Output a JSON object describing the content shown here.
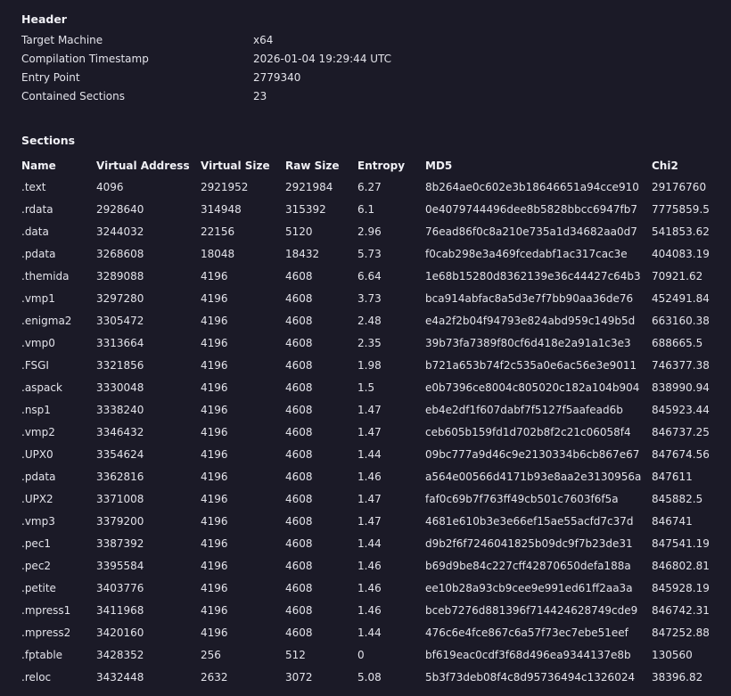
{
  "header": {
    "title": "Header",
    "fields": [
      {
        "key": "Target Machine",
        "value": "x64"
      },
      {
        "key": "Compilation Timestamp",
        "value": "2026-01-04 19:29:44 UTC"
      },
      {
        "key": "Entry Point",
        "value": "2779340"
      },
      {
        "key": "Contained Sections",
        "value": "23"
      }
    ]
  },
  "sections": {
    "title": "Sections",
    "columns": [
      "Name",
      "Virtual Address",
      "Virtual Size",
      "Raw Size",
      "Entropy",
      "MD5",
      "Chi2"
    ],
    "rows": [
      [
        ".text",
        "4096",
        "2921952",
        "2921984",
        "6.27",
        "8b264ae0c602e3b18646651a94cce910",
        "29176760"
      ],
      [
        ".rdata",
        "2928640",
        "314948",
        "315392",
        "6.1",
        "0e4079744496dee8b5828bbcc6947fb7",
        "7775859.5"
      ],
      [
        ".data",
        "3244032",
        "22156",
        "5120",
        "2.96",
        "76ead86f0c8a210e735a1d34682aa0d7",
        "541853.62"
      ],
      [
        ".pdata",
        "3268608",
        "18048",
        "18432",
        "5.73",
        "f0cab298e3a469fcedabf1ac317cac3e",
        "404083.19"
      ],
      [
        ".themida",
        "3289088",
        "4196",
        "4608",
        "6.64",
        "1e68b15280d8362139e36c44427c64b3",
        "70921.62"
      ],
      [
        ".vmp1",
        "3297280",
        "4196",
        "4608",
        "3.73",
        "bca914abfac8a5d3e7f7bb90aa36de76",
        "452491.84"
      ],
      [
        ".enigma2",
        "3305472",
        "4196",
        "4608",
        "2.48",
        "e4a2f2b04f94793e824abd959c149b5d",
        "663160.38"
      ],
      [
        ".vmp0",
        "3313664",
        "4196",
        "4608",
        "2.35",
        "39b73fa7389f80cf6d418e2a91a1c3e3",
        "688665.5"
      ],
      [
        ".FSGI",
        "3321856",
        "4196",
        "4608",
        "1.98",
        "b721a653b74f2c535a0e6ac56e3e9011",
        "746377.38"
      ],
      [
        ".aspack",
        "3330048",
        "4196",
        "4608",
        "1.5",
        "e0b7396ce8004c805020c182a104b904",
        "838990.94"
      ],
      [
        ".nsp1",
        "3338240",
        "4196",
        "4608",
        "1.47",
        "eb4e2df1f607dabf7f5127f5aafead6b",
        "845923.44"
      ],
      [
        ".vmp2",
        "3346432",
        "4196",
        "4608",
        "1.47",
        "ceb605b159fd1d702b8f2c21c06058f4",
        "846737.25"
      ],
      [
        ".UPX0",
        "3354624",
        "4196",
        "4608",
        "1.44",
        "09bc777a9d46c9e2130334b6cb867e67",
        "847674.56"
      ],
      [
        ".pdata",
        "3362816",
        "4196",
        "4608",
        "1.46",
        "a564e00566d4171b93e8aa2e3130956a",
        "847611"
      ],
      [
        ".UPX2",
        "3371008",
        "4196",
        "4608",
        "1.47",
        "faf0c69b7f763ff49cb501c7603f6f5a",
        "845882.5"
      ],
      [
        ".vmp3",
        "3379200",
        "4196",
        "4608",
        "1.47",
        "4681e610b3e3e66ef15ae55acfd7c37d",
        "846741"
      ],
      [
        ".pec1",
        "3387392",
        "4196",
        "4608",
        "1.44",
        "d9b2f6f7246041825b09dc9f7b23de31",
        "847541.19"
      ],
      [
        ".pec2",
        "3395584",
        "4196",
        "4608",
        "1.46",
        "b69d9be84c227cff42870650defa188a",
        "846802.81"
      ],
      [
        ".petite",
        "3403776",
        "4196",
        "4608",
        "1.46",
        "ee10b28a93cb9cee9e991ed61ff2aa3a",
        "845928.19"
      ],
      [
        ".mpress1",
        "3411968",
        "4196",
        "4608",
        "1.46",
        "bceb7276d881396f714424628749cde9",
        "846742.31"
      ],
      [
        ".mpress2",
        "3420160",
        "4196",
        "4608",
        "1.44",
        "476c6e4fce867c6a57f73ec7ebe51eef",
        "847252.88"
      ],
      [
        ".fptable",
        "3428352",
        "256",
        "512",
        "0",
        "bf619eac0cdf3f68d496ea9344137e8b",
        "130560"
      ],
      [
        ".reloc",
        "3432448",
        "2632",
        "3072",
        "5.08",
        "5b3f73deb08f4c8d95736494c1326024",
        "38396.82"
      ]
    ]
  }
}
